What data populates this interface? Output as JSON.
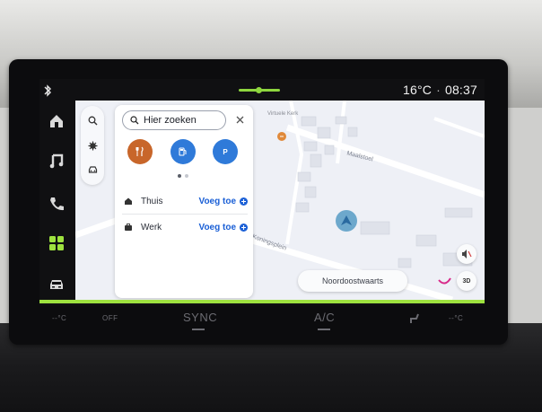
{
  "status_bar": {
    "temperature": "16°C",
    "separator": "·",
    "time": "08:37"
  },
  "rail": {
    "items": [
      {
        "name": "home",
        "active": false
      },
      {
        "name": "music",
        "active": false
      },
      {
        "name": "phone",
        "active": false
      },
      {
        "name": "apps",
        "active": true
      },
      {
        "name": "car",
        "active": false
      }
    ]
  },
  "search": {
    "placeholder": "Hier zoeken",
    "categories": [
      {
        "name": "restaurant",
        "color": "#c8662a"
      },
      {
        "name": "fuel",
        "color": "#2f7ad9"
      },
      {
        "name": "parking",
        "label": "P",
        "color": "#2f7ad9"
      }
    ]
  },
  "favorites": [
    {
      "label": "Thuis",
      "action": "Voeg toe",
      "icon": "home-icon"
    },
    {
      "label": "Werk",
      "action": "Voeg toe",
      "icon": "briefcase-icon"
    }
  ],
  "map": {
    "streets": [
      "Maalstoel",
      "Koningsplein"
    ],
    "poi_label": "Virtuele Kerk",
    "direction": "Noordoostwaarts",
    "view_mode": "3D"
  },
  "climate": {
    "left_temp": "--°C",
    "sync": "SYNC",
    "ac": "A/C",
    "right_temp": "--°C",
    "fan_label": "OFF"
  },
  "colors": {
    "accent_green": "#8ed63f",
    "link_blue": "#1a5fd6",
    "map_bg": "#eef0f6"
  }
}
